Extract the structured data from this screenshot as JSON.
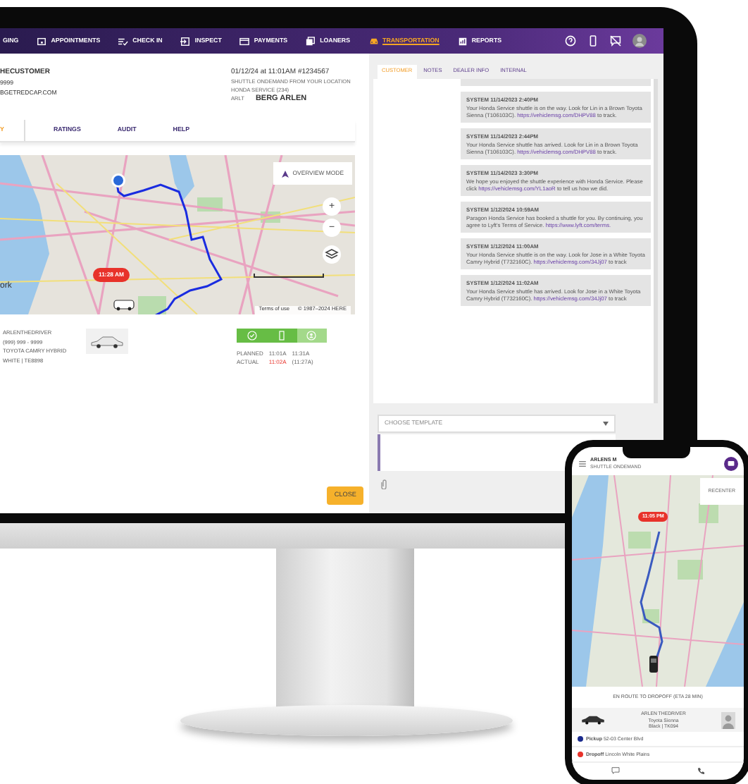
{
  "nav": {
    "items": [
      {
        "label": "GING",
        "kind": "plain",
        "selected": false
      },
      {
        "label": "APPOINTMENTS",
        "kind": "calendar",
        "selected": false
      },
      {
        "label": "CHECK IN",
        "kind": "checklist",
        "selected": false
      },
      {
        "label": "INSPECT",
        "kind": "enter",
        "selected": false
      },
      {
        "label": "PAYMENTS",
        "kind": "card",
        "selected": false
      },
      {
        "label": "LOANERS",
        "kind": "stack",
        "selected": false
      },
      {
        "label": "TRANSPORTATION",
        "kind": "car",
        "selected": true
      },
      {
        "label": "REPORTS",
        "kind": "report",
        "selected": false
      }
    ],
    "tools": [
      {
        "kind": "help"
      },
      {
        "kind": "phone"
      },
      {
        "kind": "nomsg"
      },
      {
        "kind": "avatar"
      }
    ]
  },
  "customer": {
    "name": "HECUSTOMER",
    "phone": "9999",
    "email": "BGETREDCAP.COM"
  },
  "appointment": {
    "title": "01/12/24 at 11:01AM #1234567",
    "service": "SHUTTLE ONDEMAND FROM YOUR LOCATION",
    "dealer": "HONDA SERVICE (234)",
    "driver_label": "ARLT",
    "driver": "BERG ARLEN"
  },
  "tabs": [
    {
      "label": "Y",
      "selected": true
    },
    {
      "label": "RATINGS",
      "selected": false
    },
    {
      "label": "AUDIT",
      "selected": false
    },
    {
      "label": "HELP",
      "selected": false
    }
  ],
  "map": {
    "overview": "OVERVIEW MODE",
    "time": "11:28 AM",
    "place": "ork",
    "terms": "Terms of use",
    "copyright": "© 1987–2024 HERE",
    "zoom_in": "+",
    "zoom_out": "−"
  },
  "driver": {
    "lines": [
      "ARLENTHEDRIVER",
      "(999) 999 - 9999",
      "TOYOTA CAMRY HYBRID",
      "WHITE | TE8898"
    ]
  },
  "progress": [
    {
      "kind": "check",
      "done": true
    },
    {
      "kind": "door",
      "done": true
    },
    {
      "kind": "person",
      "done": false
    }
  ],
  "times": [
    {
      "label": "PLANNED",
      "start": "11:01A",
      "end": "11:31A",
      "late": false
    },
    {
      "label": "ACTUAL",
      "start": "11:02A",
      "end": "(11:27A)",
      "late": true
    }
  ],
  "close": "CLOSE",
  "side_tabs": [
    {
      "label": "CUSTOMER",
      "selected": true
    },
    {
      "label": "NOTES",
      "selected": false
    },
    {
      "label": "DEALER INFO",
      "selected": false
    },
    {
      "label": "INTERNAL",
      "selected": false
    }
  ],
  "messages": [
    {
      "header": "SYSTEM 11/14/2023 2:40PM",
      "text": "Your  Honda Service shuttle is on the way. Look for Lin in a Brown Toyota Sienna (T106103C).",
      "link": "https://vehiclemsg.com/DHPV88",
      "after": "to track."
    },
    {
      "header": "SYSTEM 11/14/2023 2:44PM",
      "text": "Your  Honda Service shuttle has arrived. Look for Lin in a Brown Toyota Sienna (T106103C).",
      "link": "https://vehiclemsg.com/DHPV88",
      "after": "to track."
    },
    {
      "header": "SYSTEM 11/14/2023 3:30PM",
      "text": "We hope you enjoyed the shuttle experience with Honda Service. Please click",
      "link": "https://vehiclemsg.com/YL1aoR",
      "after": "to tell us how we did."
    },
    {
      "header": "SYSTEM 1/12/2024 10:59AM",
      "text": "Paragon Honda Service has booked a shuttle for you. By continuing, you agree to Lyft's Terms of Service.",
      "link": "https://www.lyft.com/terms."
    },
    {
      "header": "SYSTEM 1/12/2024 11:00AM",
      "text": "Your  Honda Service shuttle is on the way. Look for Jose in a White Toyota Camry Hybrid (T732160C).",
      "link": "https://vehiclemsg.com/34Jj07",
      "after": "to track"
    },
    {
      "header": "SYSTEM 1/12/2024 11:02AM",
      "text": "Your Honda Service shuttle has arrived. Look for Jose in a White Toyota Camry Hybrid (T732160C).",
      "link": "https://vehiclemsg.com/34Jj07",
      "after": "to track"
    }
  ],
  "template": {
    "placeholder": "CHOOSE TEMPLATE"
  },
  "phone": {
    "title": "ARLENS M",
    "subtitle": "SHUTTLE ONDEMAND",
    "recenter": "RECENTER",
    "time": "11:05 PM",
    "status": "EN ROUTE TO DROPOFF (ETA 28 MIN)",
    "driver": "ARLEN THEDRIVER",
    "vehicle": "Toyota Sienna",
    "plate": "Black | TK094",
    "stops": [
      {
        "label": "Pickup",
        "address": "52-03 Center Blvd",
        "color": "#1a2a8c"
      },
      {
        "label": "Dropoff",
        "address": "Lincoln White Plains",
        "color": "#e8322a"
      }
    ]
  }
}
